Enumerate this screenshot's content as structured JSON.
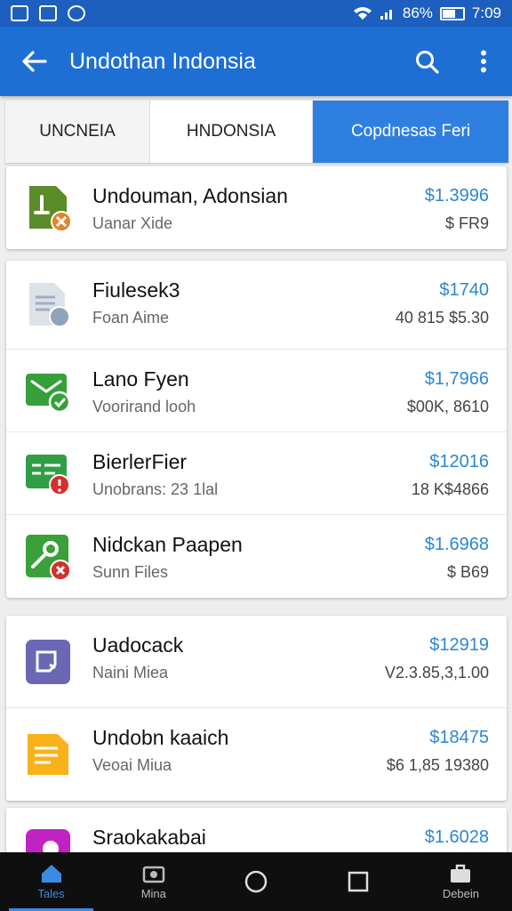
{
  "status": {
    "battery_text": "86%",
    "time": "7:09"
  },
  "app_bar": {
    "title": "Undothan Indonsia",
    "back_icon": "arrow-left-icon",
    "search_icon": "search-icon",
    "more_icon": "more-vert-icon"
  },
  "tabs": [
    {
      "label": "UNCNEIA",
      "selected": false
    },
    {
      "label": "HNDONSIA",
      "selected": false
    },
    {
      "label": "Copdnesas Feri",
      "selected": true
    }
  ],
  "items": [
    {
      "name": "Undouman, Adonsian",
      "sub": "Uanar Xide",
      "price": "$1.3996",
      "meta": "$ FR9",
      "icon": "green-file-warning-icon",
      "color": "#5b8c2a",
      "badge": "#e5822a"
    },
    {
      "name": "Fiulesek3",
      "sub": "Foan Aime",
      "price": "$1740",
      "meta": "40 815 $5.30",
      "icon": "gray-document-icon",
      "color": "#d8dde3",
      "badge": "#90a4b8"
    },
    {
      "name": "Lano Fyen",
      "sub": "Voorirand looh",
      "price": "$1,7966",
      "meta": "$00K, 8610",
      "icon": "green-mail-check-icon",
      "color": "#35a03a",
      "badge": "#35a03a"
    },
    {
      "name": "BierlerFier",
      "sub": "Unobrans: 23 1lal",
      "price": "$12016",
      "meta": "18 K$4866",
      "icon": "green-card-alert-icon",
      "color": "#2f9e45",
      "badge": "#d32f2f"
    },
    {
      "name": "Nidckan Paapen",
      "sub": "Sunn Files",
      "price": "$1.6968",
      "meta": "$ B69",
      "icon": "green-key-error-icon",
      "color": "#3aa03a",
      "badge": "#d32f2f"
    },
    {
      "name": "Uadocack",
      "sub": "Naini Miea",
      "price": "$12919",
      "meta": "V2.3.85,3,1.00",
      "icon": "purple-document-icon",
      "color": "#6a67b4",
      "badge": ""
    },
    {
      "name": "Undobn kaaich",
      "sub": "Veoai Miua",
      "price": "$18475",
      "meta": "$6 1,85 19380",
      "icon": "yellow-notes-icon",
      "color": "#f9b21c",
      "badge": ""
    },
    {
      "name": "Sraokakabai",
      "sub": "",
      "price": "$1.6028",
      "meta": "",
      "icon": "magenta-app-icon",
      "color": "#c023c2",
      "badge": ""
    }
  ],
  "nav": [
    {
      "label": "Tales",
      "icon": "home-icon",
      "active": true
    },
    {
      "label": "Mina",
      "icon": "photos-icon",
      "active": false
    },
    {
      "label": "",
      "icon": "circle-home-icon",
      "active": false
    },
    {
      "label": "",
      "icon": "square-recents-icon",
      "active": false
    },
    {
      "label": "Debein",
      "icon": "briefcase-icon",
      "active": false
    }
  ]
}
